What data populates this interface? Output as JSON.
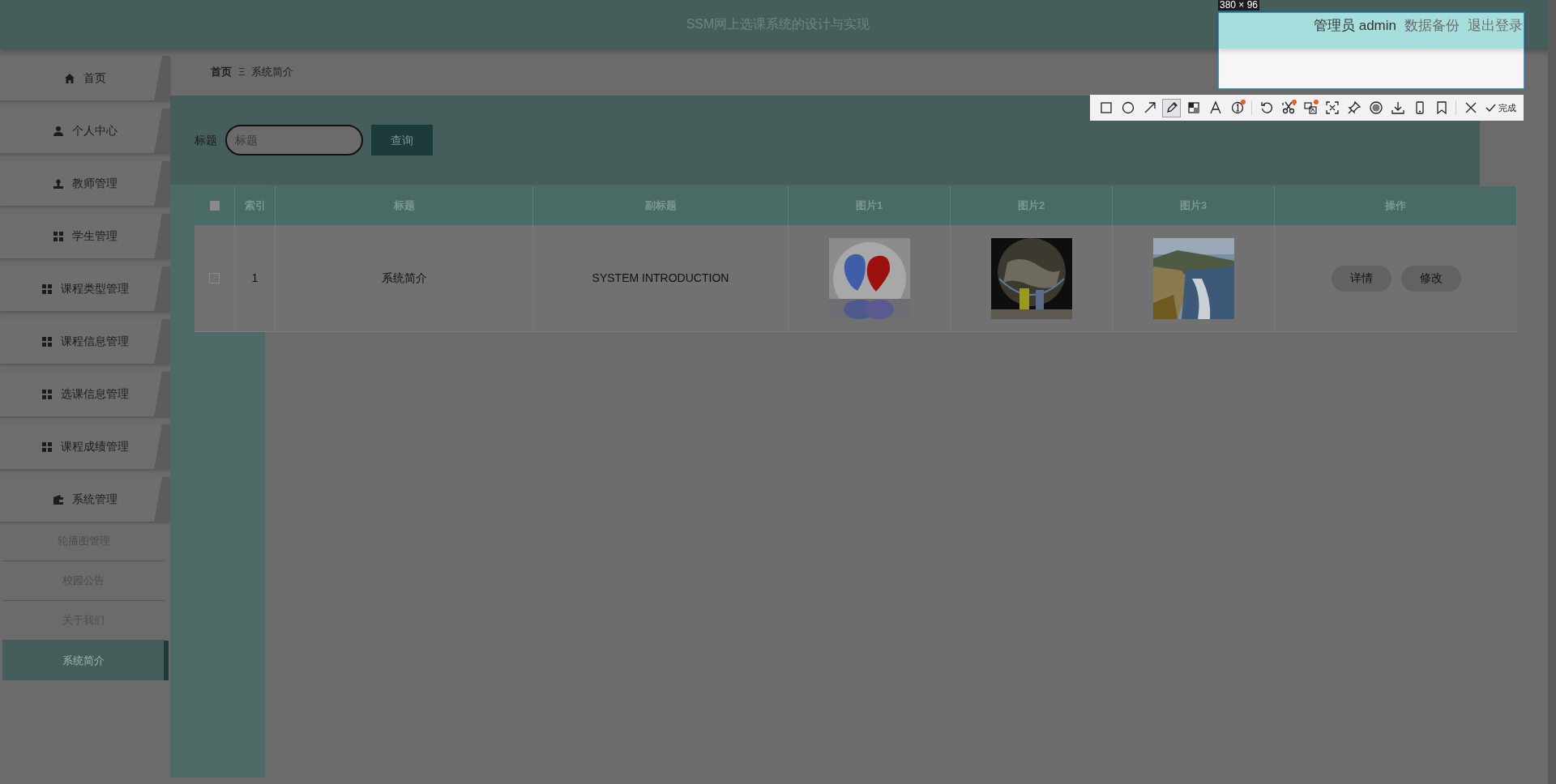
{
  "header": {
    "title": "SSM网上选课系统的设计与实现",
    "user": "管理员 admin",
    "links": [
      "数据备份",
      "退出登录"
    ]
  },
  "sidebar": {
    "items": [
      {
        "label": "首页"
      },
      {
        "label": "个人中心"
      },
      {
        "label": "教师管理"
      },
      {
        "label": "学生管理"
      },
      {
        "label": "课程类型管理"
      },
      {
        "label": "课程信息管理"
      },
      {
        "label": "选课信息管理"
      },
      {
        "label": "课程成绩管理"
      },
      {
        "label": "系统管理",
        "children": [
          {
            "label": "轮播图管理",
            "selected": false
          },
          {
            "label": "校园公告",
            "selected": false
          },
          {
            "label": "关于我们",
            "selected": false
          },
          {
            "label": "系统简介",
            "selected": true
          }
        ]
      }
    ]
  },
  "breadcrumb": {
    "home": "首页",
    "separator": "Ξ",
    "current": "系统简介"
  },
  "search": {
    "label": "标题",
    "placeholder": "标题",
    "button": "查询"
  },
  "table": {
    "all_checked": false,
    "columns": [
      "索引",
      "标题",
      "副标题",
      "图片1",
      "图片2",
      "图片3",
      "操作"
    ],
    "rows": [
      {
        "checked": false,
        "cells": [
          "1",
          "系统简介",
          "SYSTEM INTRODUCTION"
        ],
        "actions": [
          "详情",
          "修改"
        ]
      }
    ]
  },
  "screenshot_tool": {
    "size_label": "380 × 96",
    "done": "完成",
    "tool_groups": [
      [
        {
          "kind": "rectangle",
          "selected": false,
          "badge": false
        },
        {
          "kind": "ellipse",
          "selected": false,
          "badge": false
        },
        {
          "kind": "arrow",
          "selected": false,
          "badge": false
        },
        {
          "kind": "pencil",
          "selected": true,
          "badge": false
        },
        {
          "kind": "mosaic",
          "selected": false,
          "badge": false
        },
        {
          "kind": "text",
          "selected": false,
          "badge": false
        },
        {
          "kind": "number",
          "selected": false,
          "badge": true
        }
      ],
      [
        {
          "kind": "undo",
          "selected": false,
          "badge": false
        },
        {
          "kind": "scissors",
          "selected": false,
          "badge": true
        },
        {
          "kind": "translate",
          "selected": false,
          "badge": true
        },
        {
          "kind": "ocr",
          "selected": false,
          "badge": false
        },
        {
          "kind": "pin",
          "selected": false,
          "badge": false
        },
        {
          "kind": "record",
          "selected": false,
          "badge": false
        },
        {
          "kind": "download",
          "selected": false,
          "badge": false
        },
        {
          "kind": "phone",
          "selected": false,
          "badge": false
        },
        {
          "kind": "bookmark",
          "selected": false,
          "badge": false
        }
      ],
      [
        {
          "kind": "close",
          "selected": false,
          "badge": false
        }
      ]
    ]
  }
}
